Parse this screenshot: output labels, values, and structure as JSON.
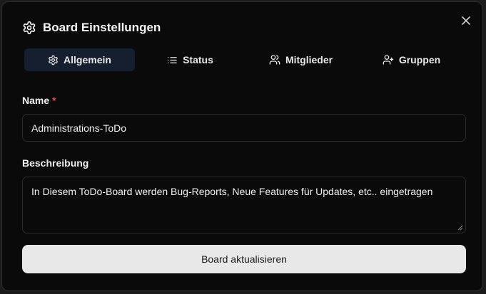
{
  "dialog": {
    "title": "Board Einstellungen",
    "title_icon": "gear-icon",
    "close_icon": "close-icon"
  },
  "tabs": [
    {
      "label": "Allgemein",
      "icon": "gear-icon",
      "active": true
    },
    {
      "label": "Status",
      "icon": "list-icon",
      "active": false
    },
    {
      "label": "Mitglieder",
      "icon": "users-icon",
      "active": false
    },
    {
      "label": "Gruppen",
      "icon": "user-plus-icon",
      "active": false
    }
  ],
  "form": {
    "name_label": "Name",
    "name_required_marker": "*",
    "name_value": "Administrations-ToDo",
    "description_label": "Beschreibung",
    "description_value": "In Diesem ToDo-Board werden Bug-Reports, Neue Features für Updates, etc.. eingetragen",
    "submit_label": "Board aktualisieren"
  },
  "colors": {
    "background": "#0a0a0a",
    "active_tab": "#161f30",
    "required": "#e5484d",
    "button": "#e8e8e8"
  }
}
